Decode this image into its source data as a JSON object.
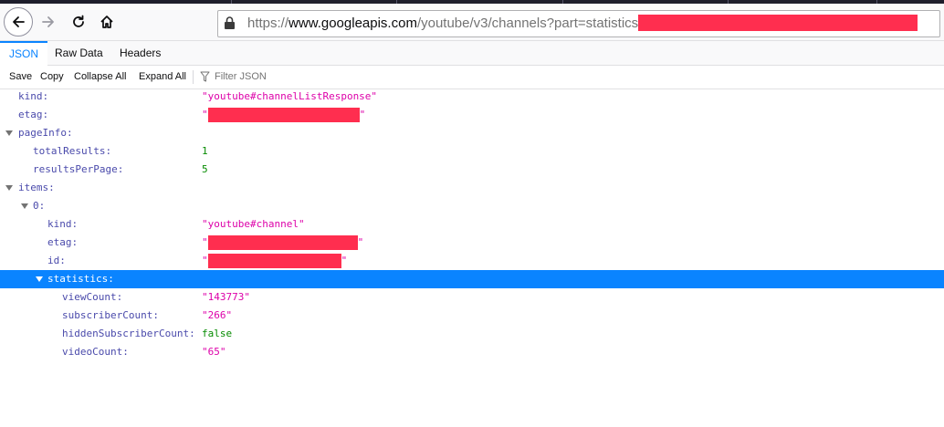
{
  "browser": {
    "url_prefix": "https://",
    "url_host": "www.googleapis.com",
    "url_path": "/youtube/v3/channels?part=statistics&id="
  },
  "viewer_tabs": [
    "JSON",
    "Raw Data",
    "Headers"
  ],
  "toolbar": {
    "save": "Save",
    "copy": "Copy",
    "collapse_all": "Collapse All",
    "expand_all": "Expand All",
    "filter_placeholder": "Filter JSON"
  },
  "json": {
    "kind_key": "kind:",
    "kind_val": "\"youtube#channelListResponse\"",
    "etag_key": "etag:",
    "quote": "\"",
    "pageinfo_key": "pageInfo:",
    "total_results_key": "totalResults:",
    "total_results_val": "1",
    "results_per_page_key": "resultsPerPage:",
    "results_per_page_val": "5",
    "items_key": "items:",
    "item0_key": "0:",
    "item_kind_key": "kind:",
    "item_kind_val": "\"youtube#channel\"",
    "item_etag_key": "etag:",
    "item_id_key": "id:",
    "statistics_key": "statistics:",
    "view_count_key": "viewCount:",
    "view_count_val": "\"143773\"",
    "subscriber_count_key": "subscriberCount:",
    "subscriber_count_val": "\"266\"",
    "hidden_sub_key": "hiddenSubscriberCount:",
    "hidden_sub_val": "false",
    "video_count_key": "videoCount:",
    "video_count_val": "\"65\""
  },
  "colors": {
    "selected_row": "#0a84ff",
    "string": "#dd00a9",
    "number": "#058b00",
    "key": "#4a4aab",
    "redaction": "#ff2e4f"
  },
  "icons": [
    "back-arrow-icon",
    "forward-arrow-icon",
    "reload-icon",
    "home-icon",
    "lock-icon",
    "filter-icon",
    "twisty-icon"
  ]
}
